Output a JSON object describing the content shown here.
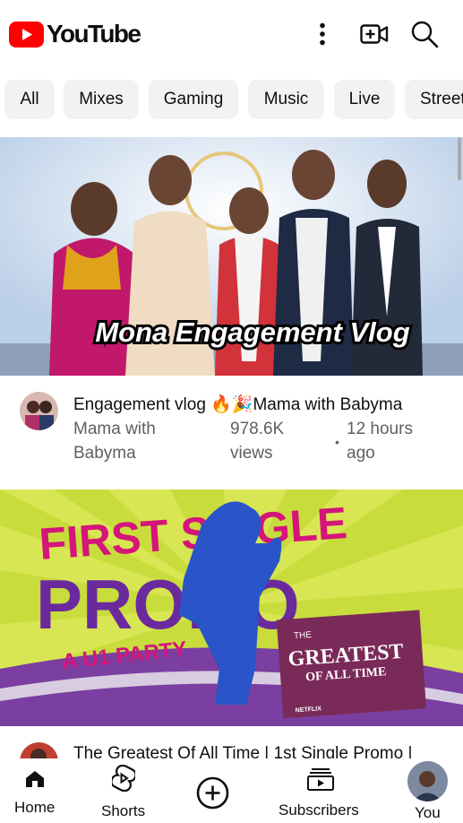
{
  "header": {
    "logo_text": "YouTube",
    "brand_color": "#ff0000",
    "icons": [
      "more-vert-icon",
      "create-video-icon",
      "search-icon"
    ]
  },
  "chips": [
    "All",
    "Mixes",
    "Gaming",
    "Music",
    "Live",
    "Street"
  ],
  "videos": [
    {
      "thumbnail_caption": "Mona Engagement Vlog",
      "title": "Engagement vlog 🔥🎉Mama with Babyma",
      "channel_line1": "Mama with",
      "channel_line2": "Babyma",
      "views_line1": "978.6K",
      "views_line2": "views",
      "separator": "•",
      "age_line1": "12 hours",
      "age_line2": "ago"
    },
    {
      "thumbnail_text": {
        "line1": "FIRST SINGLE",
        "line2": "PROMO",
        "line3": "A U1 PARTY",
        "poster_title_small": "THE",
        "poster_title": "GREATEST",
        "poster_subtitle": "OF ALL TIME",
        "credits": "NETFLIX"
      },
      "title": "The Greatest Of All Time | 1st Single Promo |"
    }
  ],
  "bottom_nav": {
    "home": "Home",
    "shorts": "Shorts",
    "subscriptions": "Subscribers",
    "you": "You"
  }
}
